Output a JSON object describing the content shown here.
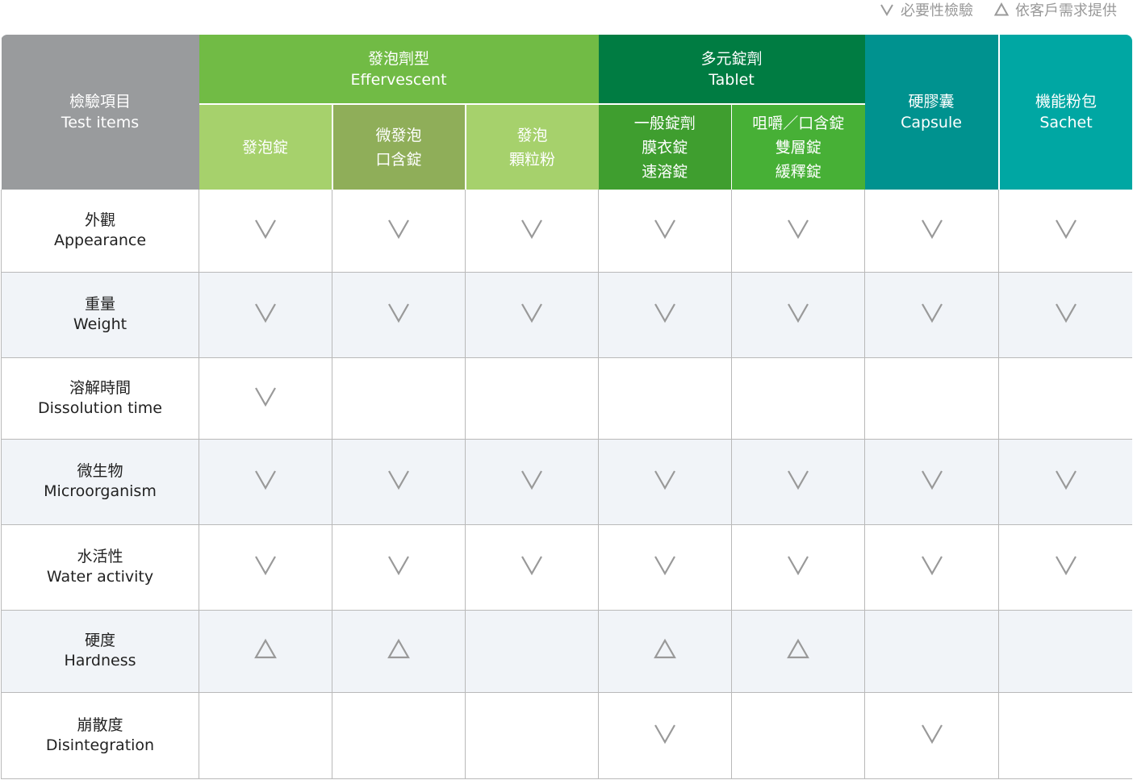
{
  "legend": [
    {
      "icon": "check-icon",
      "label": "必要性檢驗"
    },
    {
      "icon": "triangle-icon",
      "label": "依客戶需求提供"
    }
  ],
  "header": {
    "test_items": [
      "檢驗項目",
      "Test items"
    ],
    "groups": [
      {
        "lines": [
          "發泡劑型",
          "Effervescent"
        ]
      },
      {
        "lines": [
          "多元錠劑",
          "Tablet"
        ]
      },
      {
        "lines": [
          "硬膠囊",
          "Capsule"
        ]
      },
      {
        "lines": [
          "機能粉包",
          "Sachet"
        ]
      }
    ],
    "sub": [
      {
        "lines": [
          "發泡錠"
        ]
      },
      {
        "lines": [
          "微發泡",
          "口含錠"
        ]
      },
      {
        "lines": [
          "發泡",
          "顆粒粉"
        ]
      },
      {
        "lines": [
          "一般錠劑",
          "膜衣錠",
          "速溶錠"
        ]
      },
      {
        "lines": [
          "咀嚼／口含錠",
          "雙層錠",
          "緩釋錠"
        ]
      }
    ]
  },
  "rows": [
    {
      "zh": "外觀",
      "en": "Appearance",
      "marks": [
        "check",
        "check",
        "check",
        "check",
        "check",
        "check",
        "check"
      ]
    },
    {
      "zh": "重量",
      "en": "Weight",
      "marks": [
        "check",
        "check",
        "check",
        "check",
        "check",
        "check",
        "check"
      ]
    },
    {
      "zh": "溶解時間",
      "en": "Dissolution time",
      "marks": [
        "check",
        "",
        "",
        "",
        "",
        "",
        ""
      ]
    },
    {
      "zh": "微生物",
      "en": "Microorganism",
      "marks": [
        "check",
        "check",
        "check",
        "check",
        "check",
        "check",
        "check"
      ]
    },
    {
      "zh": "水活性",
      "en": "Water activity",
      "marks": [
        "check",
        "check",
        "check",
        "check",
        "check",
        "check",
        "check"
      ]
    },
    {
      "zh": "硬度",
      "en": "Hardness",
      "marks": [
        "triangle",
        "triangle",
        "",
        "triangle",
        "triangle",
        "",
        ""
      ]
    },
    {
      "zh": "崩散度",
      "en": "Disintegration",
      "marks": [
        "",
        "",
        "",
        "check",
        "",
        "check",
        ""
      ]
    }
  ],
  "colors": {
    "test_header": "#999b9d",
    "effervescent": "#71bb45",
    "tablet": "#007c42",
    "capsule": "#00928f",
    "sachet": "#00a7a3",
    "mark": "#999999",
    "alt_row": "#f1f4f8"
  }
}
